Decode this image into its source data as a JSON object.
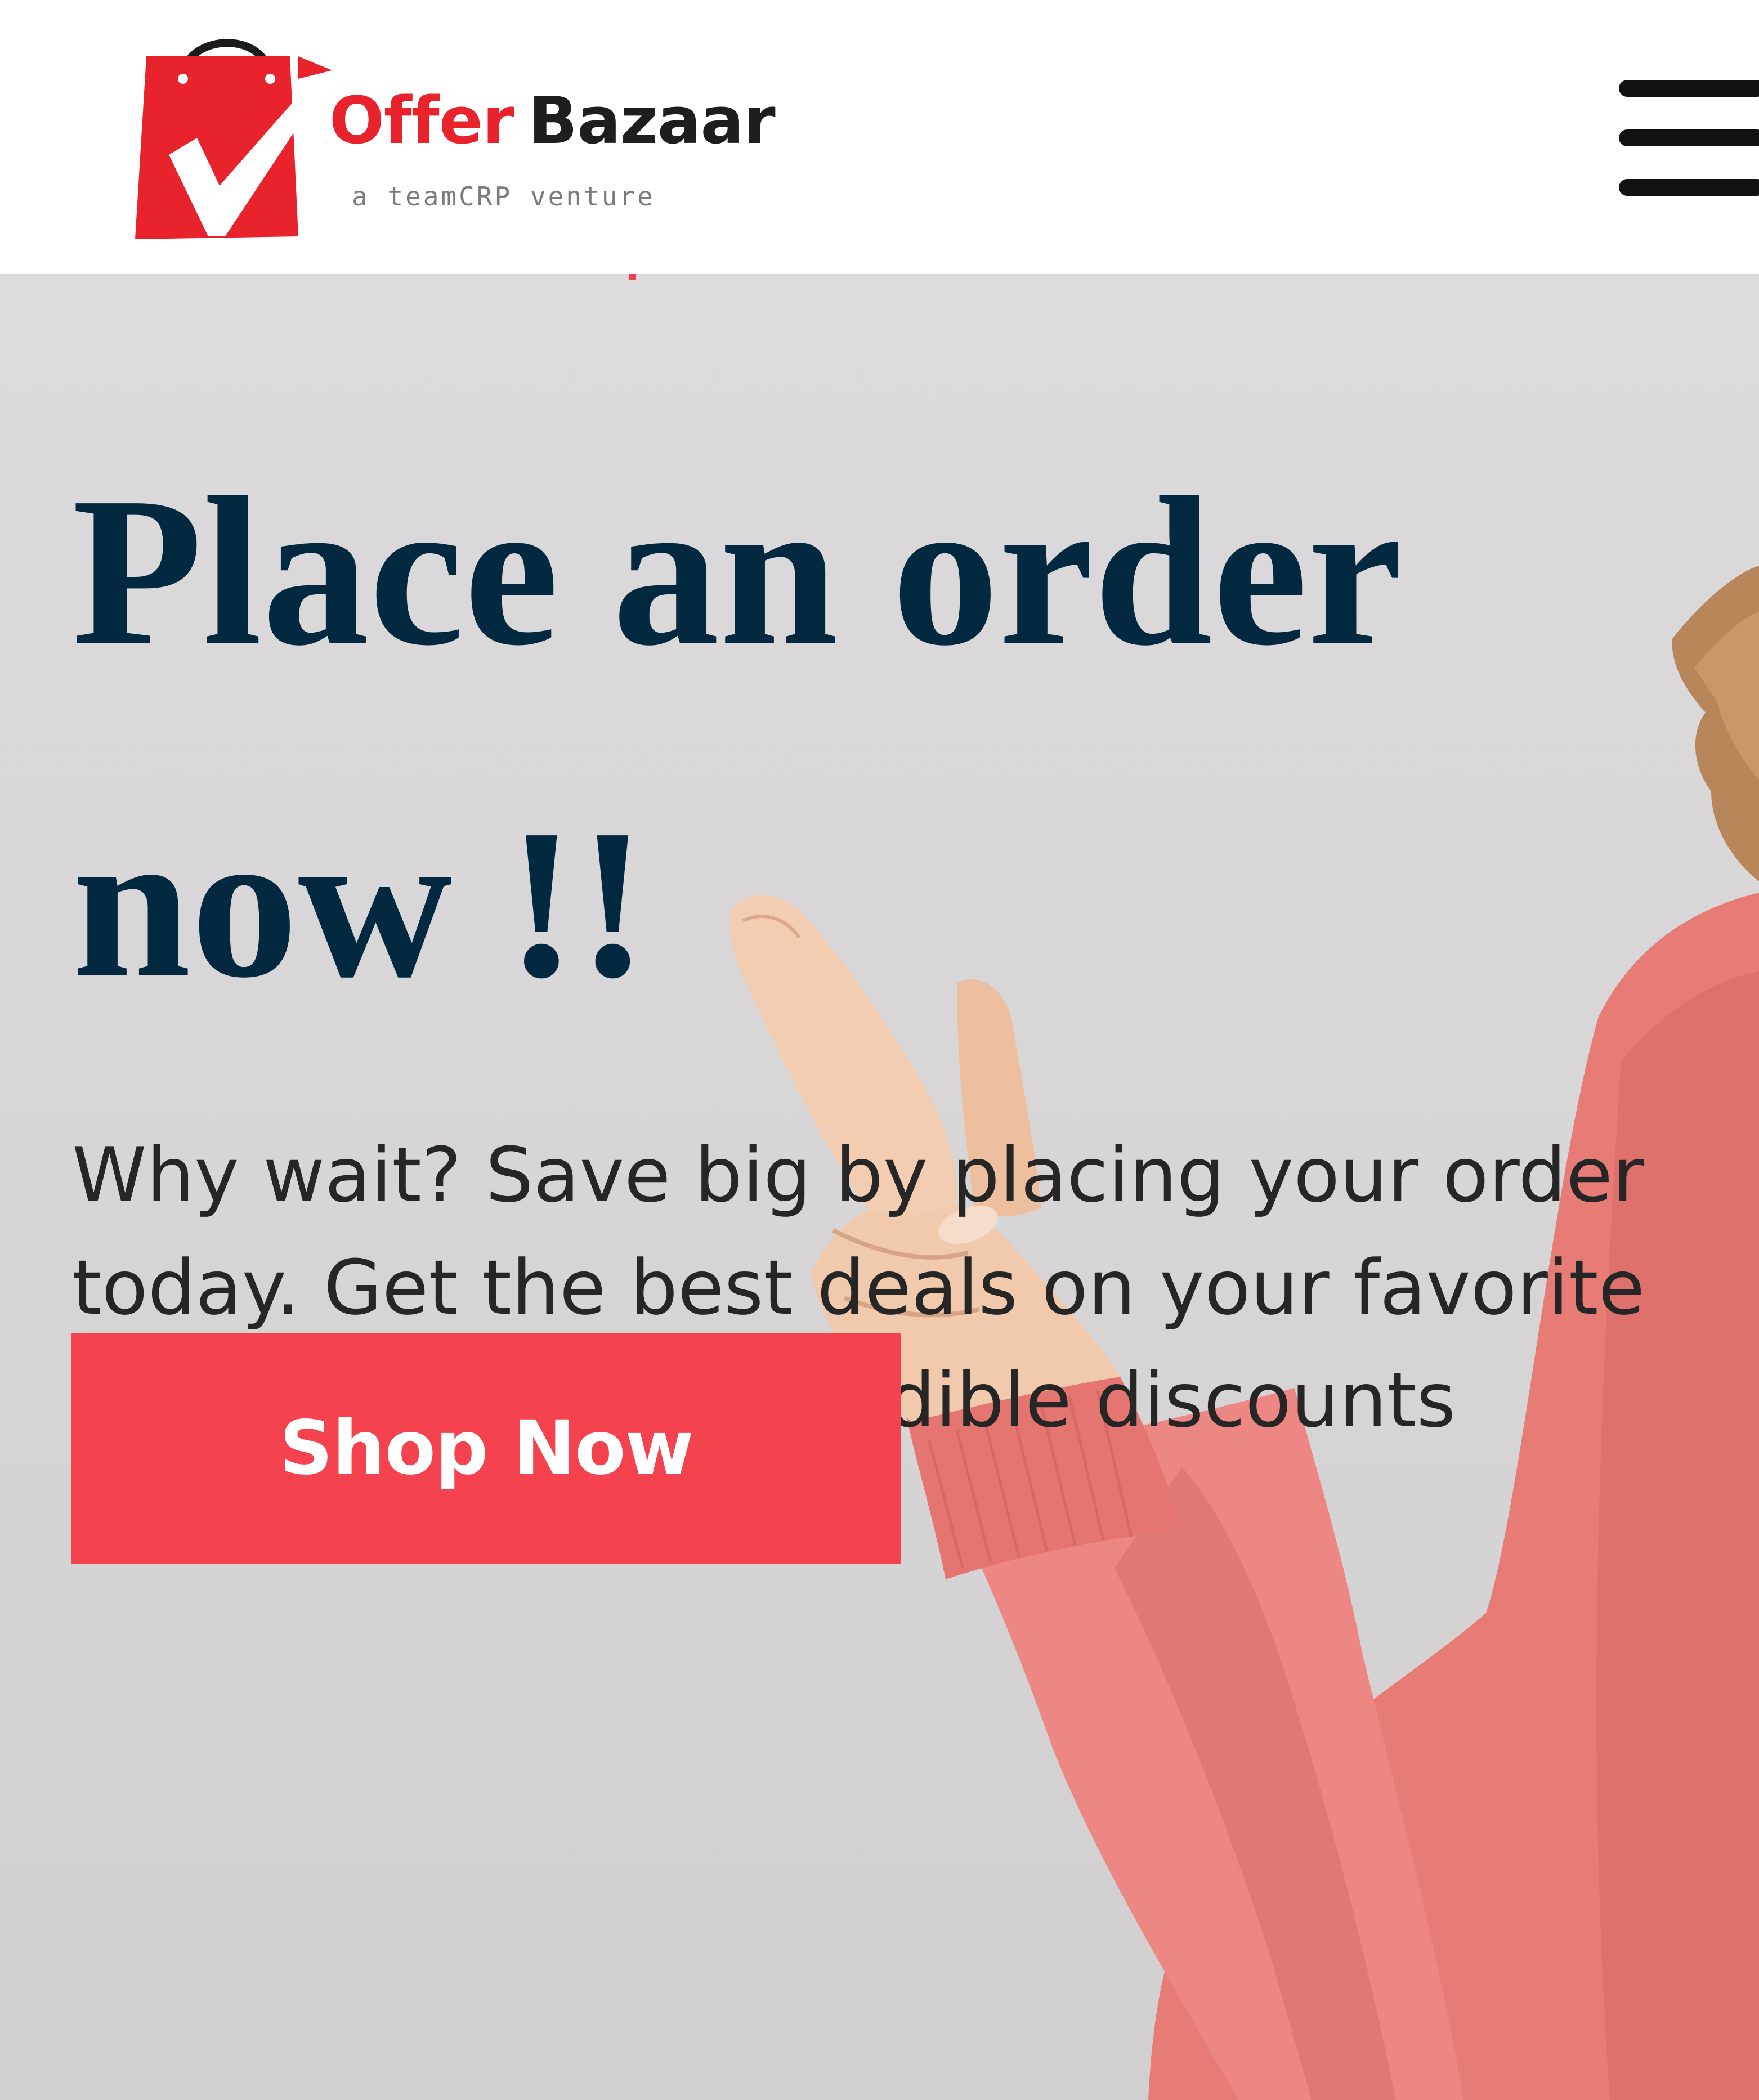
{
  "header": {
    "brand": {
      "name_part1": "Offer",
      "name_part2": "Bazaar",
      "tagline": "a teamCRP venture"
    },
    "menu_icon": "hamburger-menu-icon"
  },
  "hero": {
    "title_lines": [
      "Place an order",
      "now !!"
    ],
    "description_lines": [
      "Why wait? Save big by placing your order",
      "today. Get the best deals on your favorite",
      "items and enjoy incredible discounts"
    ],
    "cta_label": "Shop Now"
  },
  "colors": {
    "brand_red": "#e8232b",
    "cta_red": "#f5424f",
    "title_navy": "#032940",
    "sweater_pink": "#e77b76"
  }
}
